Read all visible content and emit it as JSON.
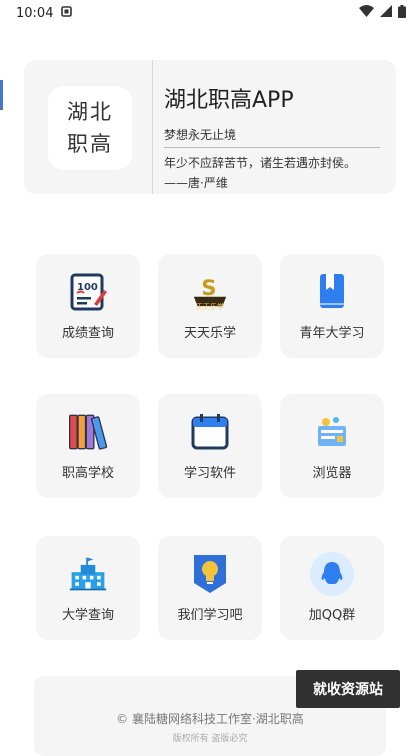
{
  "status_bar": {
    "time": "10:04"
  },
  "header": {
    "logo_line1": "湖北",
    "logo_line2": "职高",
    "title": "湖北职高APP",
    "slogan": "梦想永无止境",
    "quote_line1": "年少不应辞苦节，诸生若遇亦封侯。",
    "quote_line2": "——唐·严维"
  },
  "grid": [
    {
      "label": "成绩查询",
      "icon": "score-report-icon"
    },
    {
      "label": "天天乐学",
      "icon": "daily-learn-icon",
      "badge": "天天乐学"
    },
    {
      "label": "青年大学习",
      "icon": "bookmark-book-icon"
    },
    {
      "label": "职高学校",
      "icon": "books-icon"
    },
    {
      "label": "学习软件",
      "icon": "calendar-icon"
    },
    {
      "label": "浏览器",
      "icon": "browser-icon"
    },
    {
      "label": "大学查询",
      "icon": "university-building-icon"
    },
    {
      "label": "我们学习吧",
      "icon": "lightbulb-icon"
    },
    {
      "label": "加QQ群",
      "icon": "qq-penguin-icon"
    }
  ],
  "footer": {
    "copyright": "© 襄陆糖网络科技工作室·湖北职高",
    "sub": "版权所有 盗版必究"
  },
  "watermark": {
    "text": "就收资源站"
  },
  "colors": {
    "card_bg": "#f5f5f5",
    "accent_blue": "#2f7ef0",
    "gold": "#c89a1a"
  }
}
